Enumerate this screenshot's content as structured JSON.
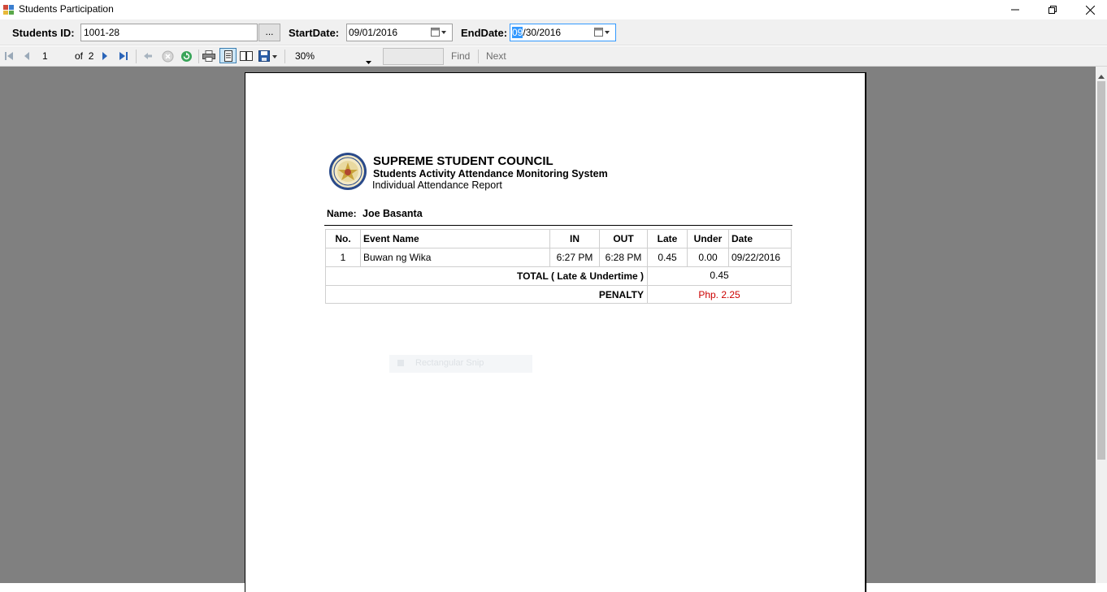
{
  "window": {
    "title": "Students Participation",
    "minimize": "minimize",
    "maximize": "restore",
    "close": "close"
  },
  "params": {
    "student_id_label": "Students ID:",
    "student_id_value": "1001-28",
    "browse_label": "...",
    "start_date_label": "StartDate:",
    "start_date_value": "09/01/2016",
    "end_date_label": "EndDate:",
    "end_date_selected": "09",
    "end_date_rest": "/30/2016"
  },
  "toolbar": {
    "current_page": "1",
    "of_label": "of",
    "total_pages": "2",
    "zoom": "30%",
    "find_label": "Find",
    "next_label": "Next"
  },
  "report": {
    "org": "SUPREME STUDENT COUNCIL",
    "system": "Students Activity Attendance Monitoring System",
    "subtitle": "Individual Attendance Report",
    "name_label": "Name:",
    "name_value": "Joe Basanta",
    "columns": [
      "No.",
      "Event Name",
      "IN",
      "OUT",
      "Late",
      "Under",
      "Date"
    ],
    "rows": [
      {
        "no": "1",
        "event": "Buwan ng Wika",
        "in": "6:27 PM",
        "out": "6:28 PM",
        "late": "0.45",
        "under": "0.00",
        "date": "09/22/2016"
      }
    ],
    "total_label": "TOTAL ( Late & Undertime )",
    "total_value": "0.45",
    "penalty_label": "PENALTY",
    "penalty_value": "Php. 2.25",
    "ghost_label": "Rectangular Snip"
  },
  "colors": {
    "viewer_bg": "#808080",
    "penalty": "#cc0000",
    "selection": "#3399ff"
  }
}
